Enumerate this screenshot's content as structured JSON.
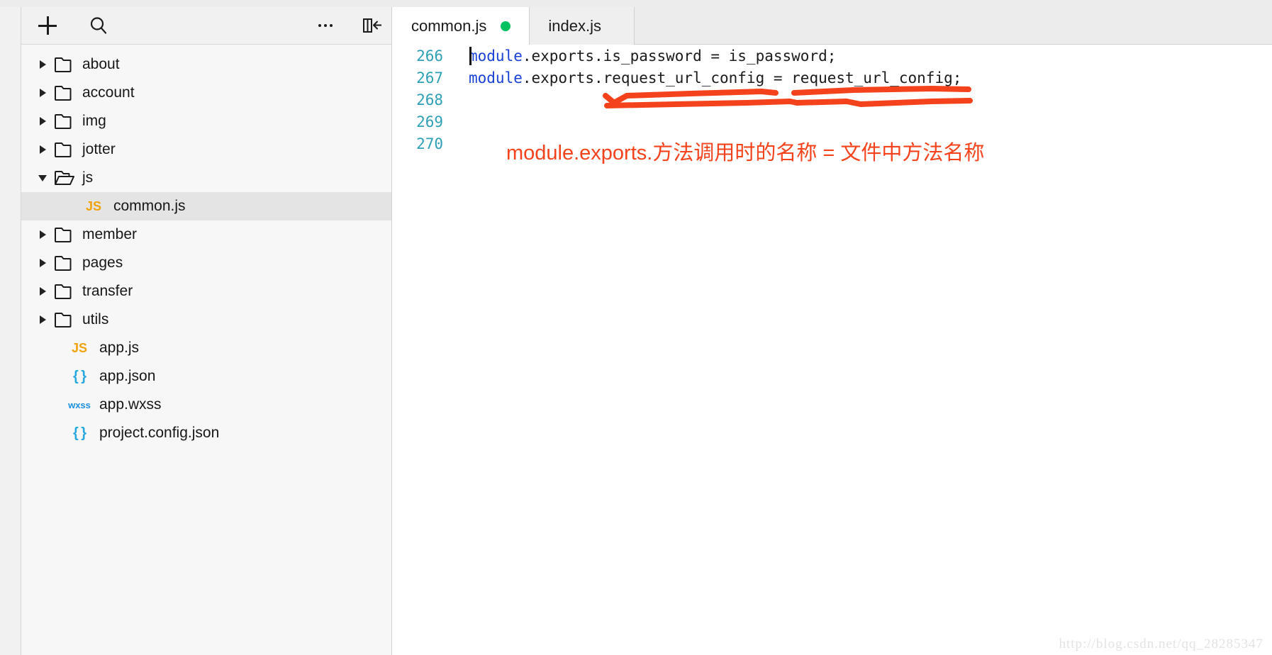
{
  "sidebar": {
    "toolbar": {
      "add_label": "+",
      "add_name": "add-icon",
      "search_name": "search-icon",
      "more_label": "...",
      "more_name": "more-icon",
      "collapse_name": "collapse-panel-icon"
    },
    "tree": [
      {
        "label": "about",
        "type": "folder",
        "expanded": false,
        "icon": "folder-icon",
        "depth": 0,
        "selected": false
      },
      {
        "label": "account",
        "type": "folder",
        "expanded": false,
        "icon": "folder-icon",
        "depth": 0,
        "selected": false
      },
      {
        "label": "img",
        "type": "folder",
        "expanded": false,
        "icon": "folder-icon",
        "depth": 0,
        "selected": false
      },
      {
        "label": "jotter",
        "type": "folder",
        "expanded": false,
        "icon": "folder-icon",
        "depth": 0,
        "selected": false
      },
      {
        "label": "js",
        "type": "folder",
        "expanded": true,
        "icon": "folder-open-icon",
        "depth": 0,
        "selected": false
      },
      {
        "label": "common.js",
        "type": "file",
        "badge": "JS",
        "badge_kind": "js",
        "depth": 1,
        "selected": true
      },
      {
        "label": "member",
        "type": "folder",
        "expanded": false,
        "icon": "folder-icon",
        "depth": 0,
        "selected": false
      },
      {
        "label": "pages",
        "type": "folder",
        "expanded": false,
        "icon": "folder-icon",
        "depth": 0,
        "selected": false
      },
      {
        "label": "transfer",
        "type": "folder",
        "expanded": false,
        "icon": "folder-icon",
        "depth": 0,
        "selected": false
      },
      {
        "label": "utils",
        "type": "folder",
        "expanded": false,
        "icon": "folder-icon",
        "depth": 0,
        "selected": false
      },
      {
        "label": "app.js",
        "type": "file",
        "badge": "JS",
        "badge_kind": "js",
        "depth": 0,
        "selected": false
      },
      {
        "label": "app.json",
        "type": "file",
        "badge": "{ }",
        "badge_kind": "json",
        "depth": 0,
        "selected": false
      },
      {
        "label": "app.wxss",
        "type": "file",
        "badge": "wxss",
        "badge_kind": "wxss",
        "depth": 0,
        "selected": false
      },
      {
        "label": "project.config.json",
        "type": "file",
        "badge": "{ }",
        "badge_kind": "json",
        "depth": 0,
        "selected": false
      }
    ]
  },
  "editor": {
    "tabs": [
      {
        "label": "common.js",
        "active": true,
        "modified": true,
        "dot_color": "#00c160"
      },
      {
        "label": "index.js",
        "active": false,
        "modified": false
      }
    ],
    "lines": [
      {
        "number": "266",
        "prefix": "module",
        "rest": ".exports.is_password = is_password;"
      },
      {
        "number": "267",
        "prefix": "module",
        "rest": ".exports.request_url_config = request_url_config;"
      },
      {
        "number": "268",
        "prefix": "",
        "rest": ""
      },
      {
        "number": "269",
        "prefix": "",
        "rest": ""
      },
      {
        "number": "270",
        "prefix": "",
        "rest": ""
      }
    ],
    "annotation": {
      "text": "module.exports.方法调用时的名称 = 文件中方法名称",
      "color": "#f4431c"
    }
  },
  "watermark": "http://blog.csdn.net/qq_28285347"
}
